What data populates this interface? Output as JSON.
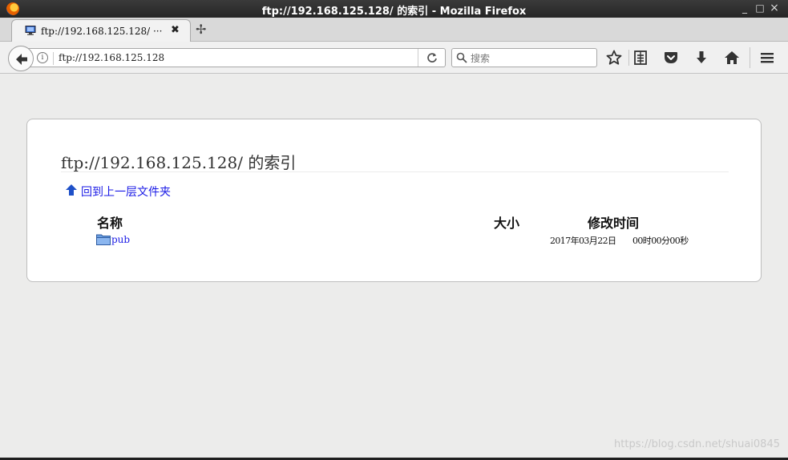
{
  "window": {
    "title": "ftp://192.168.125.128/ 的索引 - Mozilla Firefox",
    "minimize": "_",
    "maximize": "□",
    "close": "×"
  },
  "tab": {
    "title": "ftp://192.168.125.128/ ···",
    "close": "✖",
    "new_tab": "✢"
  },
  "navbar": {
    "url": "ftp://192.168.125.128",
    "reload": "C",
    "search_placeholder": "搜索"
  },
  "listing": {
    "title": "ftp://192.168.125.128/ 的索引",
    "up_link": "回到上一层文件夹",
    "columns": {
      "name": "名称",
      "size": "大小",
      "modified": "修改时间"
    },
    "rows": [
      {
        "name": "pub",
        "size": "",
        "date": "2017年03月22日",
        "time": "00时00分00秒"
      }
    ]
  },
  "watermark": "https://blog.csdn.net/shuai0845",
  "colors": {
    "link": "#1a1ae6",
    "titlebar": "#2e2e2e"
  }
}
